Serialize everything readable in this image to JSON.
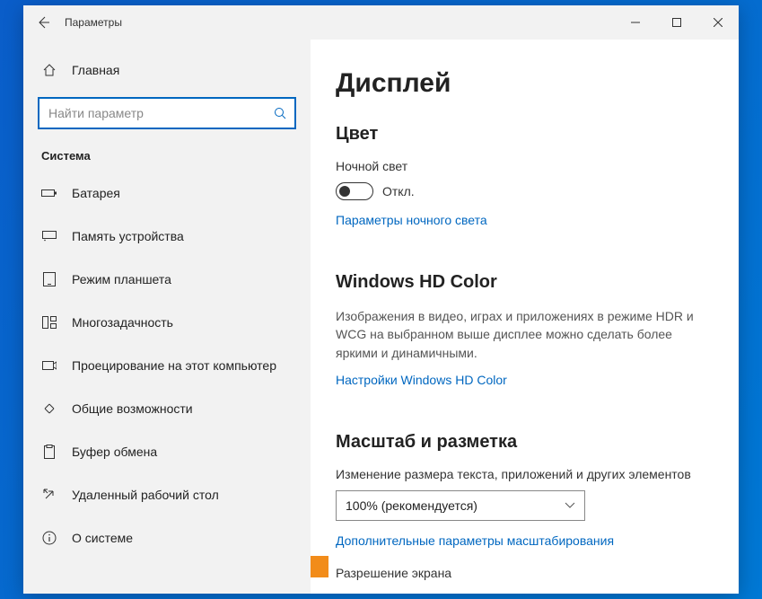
{
  "window": {
    "title": "Параметры"
  },
  "sidebar": {
    "home_label": "Главная",
    "search_placeholder": "Найти параметр",
    "section": "Система",
    "items": [
      {
        "label": "Батарея"
      },
      {
        "label": "Память устройства"
      },
      {
        "label": "Режим планшета"
      },
      {
        "label": "Многозадачность"
      },
      {
        "label": "Проецирование на этот компьютер"
      },
      {
        "label": "Общие возможности"
      },
      {
        "label": "Буфер обмена"
      },
      {
        "label": "Удаленный рабочий стол"
      },
      {
        "label": "О системе"
      }
    ]
  },
  "content": {
    "title": "Дисплей",
    "color": {
      "heading": "Цвет",
      "nightlight_label": "Ночной свет",
      "toggle_state": "Откл.",
      "settings_link": "Параметры ночного света"
    },
    "hdcolor": {
      "heading": "Windows HD Color",
      "desc": "Изображения в видео, играх и приложениях в режиме HDR и WCG на выбранном выше дисплее можно сделать более яркими и динамичными.",
      "settings_link": "Настройки Windows HD Color"
    },
    "scale": {
      "heading": "Масштаб и разметка",
      "size_label": "Изменение размера текста, приложений и других элементов",
      "size_value": "100% (рекомендуется)",
      "advanced_link": "Дополнительные параметры масштабирования",
      "resolution_label": "Разрешение экрана"
    }
  }
}
